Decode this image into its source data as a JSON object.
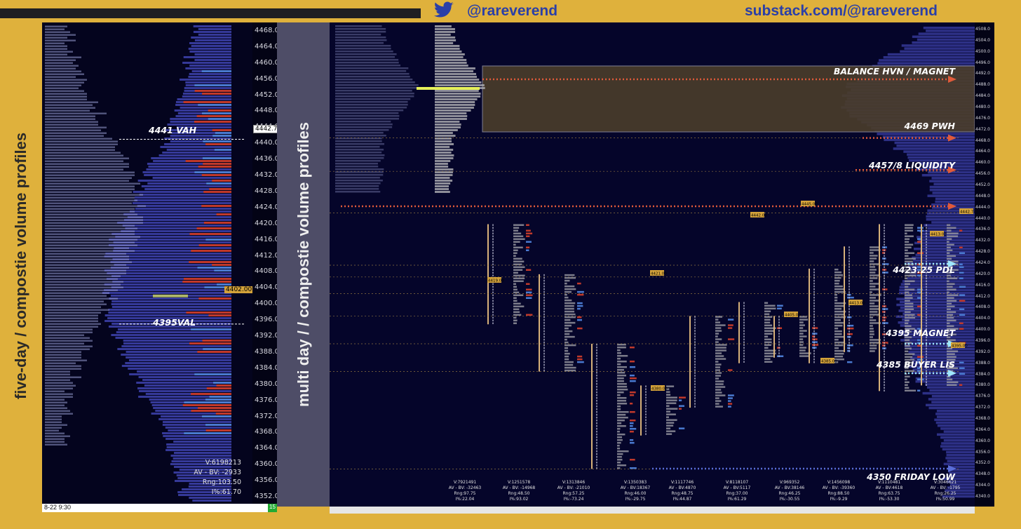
{
  "header": {
    "twitter_icon": "twitter-bird-icon",
    "twitter_handle": "@rareverend",
    "substack_url": "substack.com/@rareverend"
  },
  "side_titles": {
    "left": "five-day / compostie volume profiles",
    "middle": "multi day / / compostie volume profiles"
  },
  "colors": {
    "frame": "#dfb13c",
    "panel_bg": "#04041e",
    "profile_blue": "#3b3fa6",
    "volume_red": "#c0392b",
    "volume_blue": "#4a7ad0",
    "poc_yellow": "#e6f05a",
    "balance_box": "#4a3d2a",
    "arrow_red": "#e05a3a",
    "arrow_cyan": "#9fe8ff",
    "price_tag": "#d4a23a"
  },
  "chart_data": [
    {
      "type": "bar",
      "name": "five-day composite profile",
      "y_axis_ticks": [
        "4468.00",
        "4464.00",
        "4460.00",
        "4456.00",
        "4452.00",
        "4448.00",
        "4444.00",
        "4440.00",
        "4436.00",
        "4432.00",
        "4428.00",
        "4424.00",
        "4420.00",
        "4416.00",
        "4412.00",
        "4408.00",
        "4404.00",
        "4400.00",
        "4396.00",
        "4392.00",
        "4388.00",
        "4384.00",
        "4380.00",
        "4376.00",
        "4372.00",
        "4368.00",
        "4364.00",
        "4360.00",
        "4356.00",
        "4352.00"
      ],
      "ylim": [
        4350,
        4470
      ],
      "last_price_tag": "4442.75",
      "poc_tag": "4402.00",
      "annotations": [
        {
          "text": "4441 VAH",
          "price": 4441
        },
        {
          "text": "4395VAL",
          "price": 4395
        }
      ],
      "stats": {
        "volume": "V:6198213",
        "delta": "AV - BV: -2933",
        "range": "Rng:103.50",
        "imbalance": "I%:61.70"
      },
      "datetime": "8-22  9:30",
      "bar_count": "15"
    },
    {
      "type": "bar",
      "name": "multi day profiles",
      "y_axis_ticks": [
        "4508.00",
        "4504.00",
        "4500.00",
        "4496.00",
        "4492.00",
        "4488.00",
        "4484.00",
        "4480.00",
        "4476.00",
        "4472.00",
        "4468.00",
        "4464.00",
        "4460.00",
        "4456.00",
        "4452.00",
        "4448.00",
        "4444.00",
        "4440.00",
        "4436.00",
        "4432.00",
        "4428.00",
        "4424.00",
        "4420.00",
        "4416.00",
        "4412.00",
        "4408.00",
        "4404.00",
        "4400.00",
        "4396.00",
        "4392.00",
        "4388.00",
        "4384.00",
        "4380.00",
        "4376.00",
        "4372.00",
        "4368.00",
        "4364.00",
        "4360.00",
        "4356.00",
        "4352.00",
        "4348.00",
        "4344.00",
        "4340.00"
      ],
      "ylim": [
        4340,
        4510
      ],
      "annotations": [
        {
          "text": "BALANCE HVN / MAGNET",
          "price": 4457,
          "arrow": "red"
        },
        {
          "text": "4469 PWH",
          "price": 4469,
          "arrow": "red"
        },
        {
          "text": "4457/8 LIQUIDITY",
          "price": 4457.5,
          "arrow": "red"
        },
        {
          "text": "4423.25 PDL",
          "price": 4423.25,
          "arrow": "cyan"
        },
        {
          "text": "4395 MAGNET",
          "price": 4395,
          "arrow": "cyan"
        },
        {
          "text": "4385 BUYER LIS",
          "price": 4385,
          "arrow": "cyan"
        },
        {
          "text": "4350 FRIDAY LOW",
          "price": 4350,
          "arrow": "blue"
        }
      ],
      "price_tags": [
        "4419.00",
        "4421.00",
        "4442.00",
        "4445.00",
        "4413.00",
        "4405.00",
        "4395.00",
        "4385.00",
        "4380.00",
        "4442.75",
        "4413.00"
      ],
      "day_stats": [
        {
          "volume": "V:7921491",
          "delta": "AV - BV: -32463",
          "range": "Rng:97.75",
          "imbalance": "I%:22.04"
        },
        {
          "volume": "V:1251578",
          "delta": "AV - BV: -14968",
          "range": "Rng:48.50",
          "imbalance": "I%:93.02"
        },
        {
          "volume": "V:1313846",
          "delta": "AV - BV: -21010",
          "range": "Rng:57.25",
          "imbalance": "I%:-73.24"
        },
        {
          "volume": "V:1350383",
          "delta": "AV - BV:18367",
          "range": "Rng:46.00",
          "imbalance": "I%:-29.75"
        },
        {
          "volume": "V:1117746",
          "delta": "AV - BV:4870",
          "range": "Rng:48.75",
          "imbalance": "I%:44.87"
        },
        {
          "volume": "V:8118107",
          "delta": "AV - BV:5117",
          "range": "Rng:37.00",
          "imbalance": "I%:61.29"
        },
        {
          "volume": "V:969352",
          "delta": "AV - BV:38146",
          "range": "Rng:46.25",
          "imbalance": "I%:-30.55"
        },
        {
          "volume": "V:1456098",
          "delta": "AV - BV: -39360",
          "range": "Rng:88.50",
          "imbalance": "I%:-9.29"
        },
        {
          "volume": "V:1110481",
          "delta": "AV - BV:4618",
          "range": "Rng:63.75",
          "imbalance": "I%:-53.30"
        },
        {
          "volume": "V:3046621",
          "delta": "AV - BV: -1795",
          "range": "Rng:26.25",
          "imbalance": "I%:50.99"
        }
      ]
    }
  ]
}
